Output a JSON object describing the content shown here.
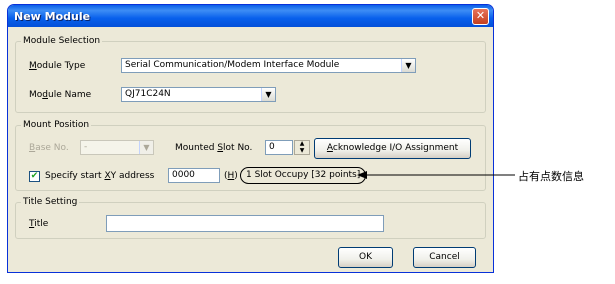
{
  "window": {
    "title": "New Module",
    "close_glyph": "✕"
  },
  "module_selection": {
    "legend": "Module Selection",
    "module_type": {
      "label_pre": "",
      "label_key": "M",
      "label_post": "odule Type",
      "value": "Serial Communication/Modem Interface Module"
    },
    "module_name": {
      "label_pre": "Mo",
      "label_key": "d",
      "label_post": "ule Name",
      "value": "QJ71C24N"
    }
  },
  "mount_position": {
    "legend": "Mount Position",
    "base_no": {
      "label_pre": "",
      "label_key": "B",
      "label_post": "ase No.",
      "value": "-"
    },
    "mounted_slot": {
      "label_pre": "Mounted ",
      "label_key": "S",
      "label_post": "lot No.",
      "value": "0"
    },
    "ack_button": {
      "label_pre": "",
      "label_key": "A",
      "label_post": "cknowledge I/O Assignment"
    },
    "specify_xy": {
      "checked": true,
      "check_glyph": "✔",
      "label_pre": "Specify start ",
      "label_key": "X",
      "label_post": "Y address",
      "value": "0000",
      "hex_suffix_pre": "(",
      "hex_suffix_key": "H",
      "hex_suffix_post": ")"
    },
    "slot_occupy": "1 Slot Occupy [32 points]"
  },
  "title_setting": {
    "legend": "Title Setting",
    "title": {
      "label_pre": "",
      "label_key": "T",
      "label_post": "itle",
      "value": ""
    }
  },
  "buttons": {
    "ok": "OK",
    "cancel": "Cancel"
  },
  "annotation": {
    "text": "占有点数信息"
  },
  "glyphs": {
    "combo_arrow": "▼",
    "spin_up": "▲",
    "spin_down": "▼"
  },
  "colors": {
    "titlebar": "#0a5ee8",
    "dialog_bg": "#ece9d8",
    "close_button": "#d35b3e"
  }
}
